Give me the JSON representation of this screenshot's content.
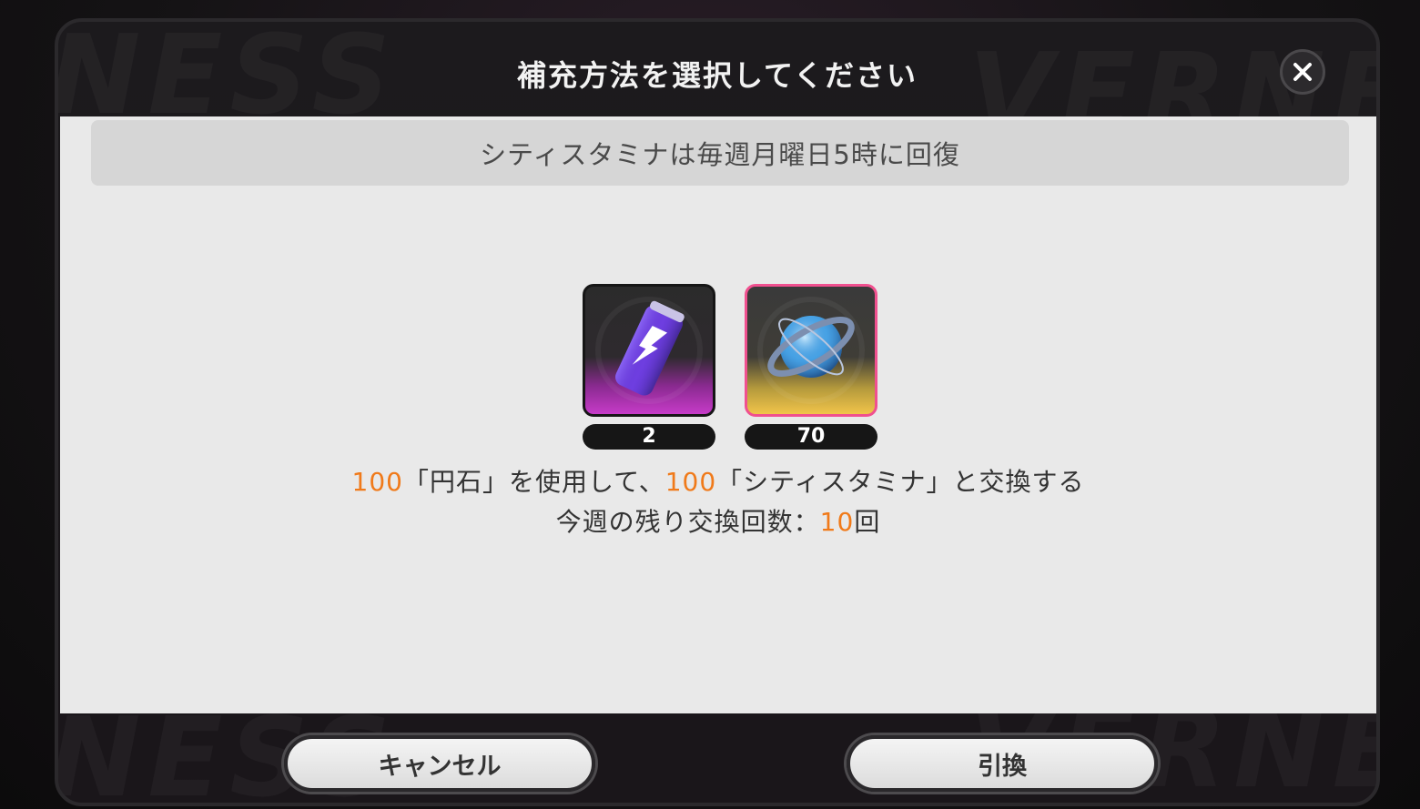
{
  "dialog": {
    "title": "補充方法を選択してください",
    "notice": "シティスタミナは毎週月曜日5時に回復"
  },
  "items": [
    {
      "name": "energy-drink",
      "count": "2"
    },
    {
      "name": "yen-stone",
      "count": "70"
    }
  ],
  "exchange": {
    "cost_amount": "100",
    "cost_text": "「円石」を使用して、",
    "gain_amount": "100",
    "gain_text": "「シティスタミナ」と交換する",
    "remaining_label": "今週の残り交換回数：",
    "remaining_count": "10",
    "remaining_unit": "回"
  },
  "buttons": {
    "cancel": "キャンセル",
    "confirm": "引換"
  },
  "colors": {
    "highlight": "#f07a1a",
    "stone_frame": "#f0508f"
  },
  "icons": [
    "close-icon",
    "energy-drink-icon",
    "yen-stone-icon"
  ]
}
